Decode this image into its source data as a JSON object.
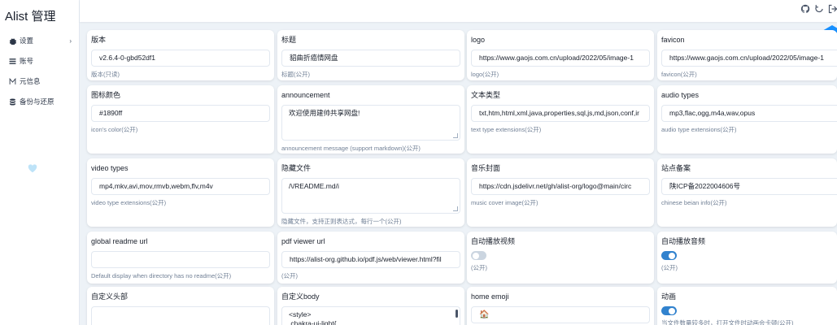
{
  "app": {
    "title": "Alist 管理"
  },
  "sidebar": {
    "items": [
      {
        "label": "设置",
        "icon": "gear-icon"
      },
      {
        "label": "账号",
        "icon": "list-icon"
      },
      {
        "label": "元信息",
        "icon": "meta-icon"
      },
      {
        "label": "备份与还原",
        "icon": "database-icon"
      }
    ]
  },
  "colors": {
    "accent": "#1890ff",
    "toggle_on": "#3182ce",
    "toggle_off": "#cbd5e0"
  },
  "settings": {
    "version": {
      "label": "版本",
      "value": "v2.6.4-0-gbd52df1",
      "help": "版本(只读)"
    },
    "title": {
      "label": "标题",
      "value": "貂曲折癌情网盘",
      "help": "标题(公开)"
    },
    "logo": {
      "label": "logo",
      "value": "https://www.gaojs.com.cn/upload/2022/05/image-1",
      "help": "logo(公开)"
    },
    "favicon": {
      "label": "favicon",
      "value": "https://www.gaojs.com.cn/upload/2022/05/image-1",
      "help": "favicon(公开)"
    },
    "icon_color": {
      "label": "图标颜色",
      "value": "#1890ff",
      "help": "icon's color(公开)"
    },
    "announcement": {
      "label": "announcement",
      "value": "欢迎使用建帅共享网盘!",
      "help": "announcement message (support markdown)(公开)"
    },
    "text_types": {
      "label": "文本类型",
      "value": "txt,htm,html,xml,java,properties,sql,js,md,json,conf,ir",
      "help": "text type extensions(公开)"
    },
    "audio_types": {
      "label": "audio types",
      "value": "mp3,flac,ogg,m4a,wav,opus",
      "help": "audio type extensions(公开)"
    },
    "video_types": {
      "label": "video types",
      "value": "mp4,mkv,avi,mov,rmvb,webm,flv,m4v",
      "help": "video type extensions(公开)"
    },
    "hide_files": {
      "label": "隐藏文件",
      "value": "/\\/README.md/i",
      "help": "隐藏文件，支持正则表达式，每行一个(公开)"
    },
    "music_cover": {
      "label": "音乐封面",
      "value": "https://cdn.jsdelivr.net/gh/alist-org/logo@main/circ",
      "help": "music cover image(公开)"
    },
    "site_beian": {
      "label": "站点备案",
      "value": "陕ICP备2022004606号",
      "help": "chinese beian info(公开)"
    },
    "global_readme_url": {
      "label": "global readme url",
      "value": "",
      "help": "Default display when directory has no readme(公开)"
    },
    "pdf_viewer_url": {
      "label": "pdf viewer url",
      "value": "https://alist-org.github.io/pdf.js/web/viewer.html?fil",
      "help": "(公开)"
    },
    "autoplay_video": {
      "label": "自动播放视频",
      "enabled": false,
      "help": "(公开)"
    },
    "autoplay_audio": {
      "label": "自动播放音频",
      "enabled": true,
      "help": "(公开)"
    },
    "custom_head": {
      "label": "自定义头部",
      "value": ""
    },
    "custom_body": {
      "label": "自定义body",
      "value": "<style>\n.chakra-ui-light{"
    },
    "home_emoji": {
      "label": "home emoji",
      "value": "🏠"
    },
    "animation": {
      "label": "动画",
      "enabled": true,
      "help": "当文件数量较多时，打开文件时动画会卡顿(公开)"
    }
  }
}
